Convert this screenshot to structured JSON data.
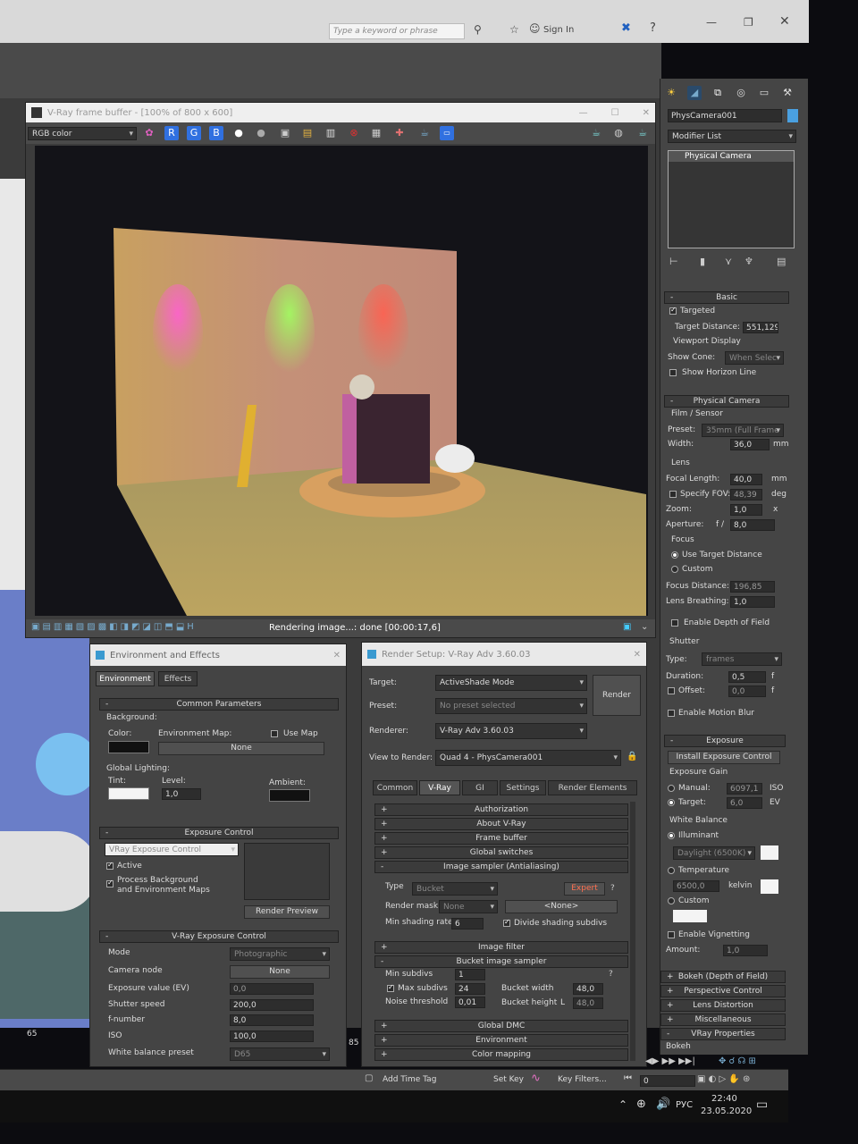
{
  "top_toolbar": {
    "search_placeholder": "Type a keyword or phrase",
    "sign_in": "Sign In"
  },
  "vfb": {
    "title": "V-Ray frame buffer - [100% of 800 x 600]",
    "channel": "RGB color",
    "ch_r": "R",
    "ch_g": "G",
    "ch_b": "B",
    "status": "Rendering image...: done [00:00:17,6]"
  },
  "command_panel": {
    "object_name": "PhysCamera001",
    "modifier_list": "Modifier List",
    "stack_item": "Physical Camera",
    "basic": {
      "title": "Basic",
      "targeted": "Targeted",
      "target_distance_label": "Target Distance:",
      "target_distance": "551,129",
      "viewport_display": "Viewport Display",
      "show_cone_label": "Show Cone:",
      "show_cone": "When Selec",
      "show_horizon": "Show Horizon Line"
    },
    "physical_camera": {
      "title": "Physical Camera",
      "film_sensor": "Film / Sensor",
      "preset_label": "Preset:",
      "preset": "35mm (Full Frame",
      "width_label": "Width:",
      "width": "36,0",
      "width_unit": "mm",
      "lens": "Lens",
      "focal_label": "Focal Length:",
      "focal": "40,0",
      "focal_unit": "mm",
      "fov_label": "Specify FOV:",
      "fov": "48,39",
      "fov_unit": "deg",
      "zoom_label": "Zoom:",
      "zoom": "1,0",
      "zoom_unit": "x",
      "aperture_label": "Aperture:",
      "aperture_f": "f /",
      "aperture": "8,0",
      "focus": "Focus",
      "use_target": "Use Target Distance",
      "custom": "Custom",
      "focus_distance_label": "Focus Distance:",
      "focus_distance": "196,85",
      "lens_breathing_label": "Lens Breathing:",
      "lens_breathing": "1,0",
      "dof": "Enable Depth of Field"
    },
    "shutter": {
      "title": "Shutter",
      "type_label": "Type:",
      "type": "frames",
      "duration_label": "Duration:",
      "duration": "0,5",
      "duration_unit": "f",
      "offset_label": "Offset:",
      "offset": "0,0",
      "offset_unit": "f",
      "motion_blur": "Enable Motion Blur"
    },
    "exposure": {
      "title": "Exposure",
      "install_button": "Install Exposure Control",
      "exposure_gain": "Exposure Gain",
      "manual_label": "Manual:",
      "manual": "6097,1",
      "manual_unit": "ISO",
      "target_label": "Target:",
      "target": "6,0",
      "target_unit": "EV",
      "white_balance": "White Balance",
      "illuminant": "Illuminant",
      "illuminant_value": "Daylight (6500K)",
      "temperature": "Temperature",
      "temperature_value": "6500,0",
      "kelvin": "kelvin",
      "custom": "Custom",
      "vignetting": "Enable Vignetting",
      "amount_label": "Amount:",
      "amount": "1,0"
    },
    "collapsed": [
      "Bokeh (Depth of Field)",
      "Perspective Control",
      "Lens Distortion",
      "Miscellaneous",
      "VRay Properties"
    ],
    "cut_label": "Bokeh"
  },
  "env_effects": {
    "title": "Environment and Effects",
    "tab_environment": "Environment",
    "tab_effects": "Effects",
    "common_params": "Common Parameters",
    "background": "Background:",
    "color": "Color:",
    "env_map": "Environment Map:",
    "use_map": "Use Map",
    "none": "None",
    "global_lighting": "Global Lighting:",
    "tint": "Tint:",
    "level": "Level:",
    "level_value": "1,0",
    "ambient": "Ambient:",
    "exposure_control": "Exposure Control",
    "exposure_type": "VRay Exposure Control",
    "active": "Active",
    "process_bg_1": "Process Background",
    "process_bg_2": "and Environment Maps",
    "render_preview": "Render Preview",
    "vray_exposure": "V-Ray Exposure Control",
    "mode_label": "Mode",
    "mode": "Photographic",
    "camera_node_label": "Camera node",
    "camera_node": "None",
    "ev_label": "Exposure value (EV)",
    "ev": "0,0",
    "shutter_label": "Shutter speed",
    "shutter": "200,0",
    "fnumber_label": "f-number",
    "fnumber": "8,0",
    "iso_label": "ISO",
    "iso": "100,0",
    "wb_label": "White balance preset",
    "wb": "D65"
  },
  "render_setup": {
    "title": "Render Setup: V-Ray Adv 3.60.03",
    "target_label": "Target:",
    "target": "ActiveShade Mode",
    "preset_label": "Preset:",
    "preset": "No preset selected",
    "renderer_label": "Renderer:",
    "renderer": "V-Ray Adv 3.60.03",
    "view_label": "View to Render:",
    "view": "Quad 4 - PhysCamera001",
    "render_button": "Render",
    "tabs": [
      "Common",
      "V-Ray",
      "GI",
      "Settings",
      "Render Elements"
    ],
    "rollouts_top": [
      "Authorization",
      "About V-Ray",
      "Frame buffer",
      "Global switches"
    ],
    "image_sampler": "Image sampler (Antialiasing)",
    "type_label": "Type",
    "type": "Bucket",
    "expert": "Expert",
    "render_mask_label": "Render mask",
    "render_mask": "None",
    "render_mask_none": "<None>",
    "min_shading_label": "Min shading rate",
    "min_shading": "6",
    "divide_shading": "Divide shading subdivs",
    "image_filter": "Image filter",
    "bucket_sampler": "Bucket image sampler",
    "min_subdivs_label": "Min subdivs",
    "min_subdivs": "1",
    "max_subdivs_label": "Max subdivs",
    "max_subdivs": "24",
    "noise_label": "Noise threshold",
    "noise": "0,01",
    "bucket_width_label": "Bucket width",
    "bucket_width": "48,0",
    "bucket_height_label": "Bucket height",
    "bucket_height": "48,0",
    "bucket_l": "L",
    "rollouts_bottom": [
      "Global DMC",
      "Environment",
      "Color mapping"
    ]
  },
  "timeline": {
    "tick_65": "65",
    "tick_85": "85",
    "add_time_tag": "Add Time Tag",
    "set_key": "Set Key",
    "key_filters": "Key Filters...",
    "frame": "0"
  },
  "taskbar": {
    "lang": "РУС",
    "time": "22:40",
    "date": "23.05.2020"
  }
}
